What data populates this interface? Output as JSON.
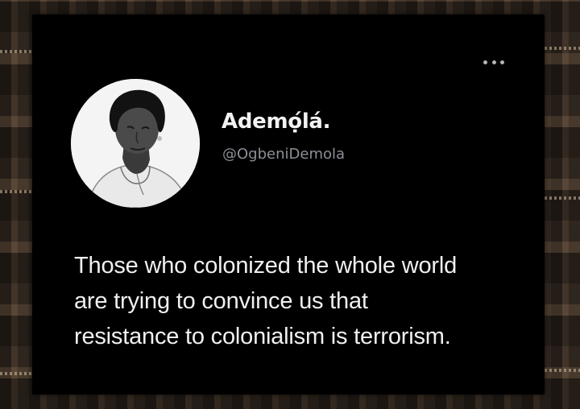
{
  "post": {
    "author": {
      "display_name": "Ademọ́lá.",
      "handle": "@OgbeniDemola",
      "avatar_icon": "profile-photo"
    },
    "more_icon": "more-options-icon",
    "text_lines": [
      "Those who colonized the whole world",
      "are trying to convince us that",
      "resistance to colonialism is terrorism."
    ]
  },
  "colors": {
    "card_background": "#000000",
    "name_text": "#f2f2f2",
    "handle_text": "#8b9096",
    "body_text": "#f0f0f0"
  }
}
